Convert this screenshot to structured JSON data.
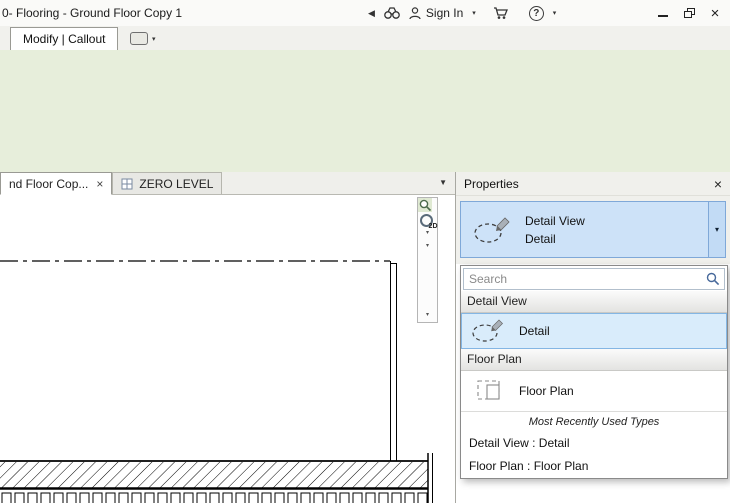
{
  "title_bar": {
    "title": "0- Flooring - Ground Floor Copy 1",
    "sign_in_label": "Sign In"
  },
  "ribbon": {
    "active_tab": "Modify | Callout"
  },
  "view_tabs": {
    "tab1": "nd Floor Cop...",
    "tab2": "ZERO LEVEL"
  },
  "nav_bar": {
    "wheel_label": "2D"
  },
  "properties_panel": {
    "title": "Properties",
    "type_selector": {
      "family": "Detail View",
      "type": "Detail"
    },
    "dropdown": {
      "search_placeholder": "Search",
      "group1_header": "Detail View",
      "group1_item": "Detail",
      "group2_header": "Floor Plan",
      "group2_item": "Floor Plan",
      "mru_header": "Most Recently Used Types",
      "mru_item1": "Detail View : Detail",
      "mru_item2": "Floor Plan : Floor Plan"
    }
  },
  "colors": {
    "ribbon_green": "#e7eedb",
    "selection_blue": "#cde2f8",
    "highlight_blue": "#d9ecfb"
  }
}
